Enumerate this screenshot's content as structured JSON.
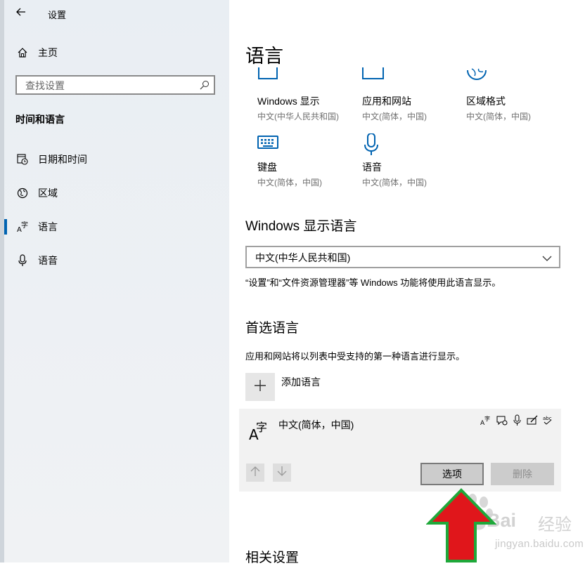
{
  "window": {
    "title": "设置"
  },
  "sidebar": {
    "home_label": "主页",
    "search_placeholder": "查找设置",
    "section_label": "时间和语言",
    "items": [
      {
        "label": "日期和时间",
        "icon": "calendar-clock-icon"
      },
      {
        "label": "区域",
        "icon": "globe-icon"
      },
      {
        "label": "语言",
        "icon": "language-icon",
        "active": true
      },
      {
        "label": "语音",
        "icon": "microphone-icon"
      }
    ]
  },
  "main": {
    "title": "语言",
    "tiles": [
      {
        "name": "Windows 显示",
        "sub": "中文(中华人民共和国)",
        "icon": "monitor-icon"
      },
      {
        "name": "应用和网站",
        "sub": "中文(简体，中国)",
        "icon": "app-window-icon"
      },
      {
        "name": "区域格式",
        "sub": "中文(简体，中国)",
        "icon": "region-format-icon"
      },
      {
        "name": "键盘",
        "sub": "中文(简体，中国)",
        "icon": "keyboard-icon"
      },
      {
        "name": "语音",
        "sub": "中文(简体，中国)",
        "icon": "microphone-icon"
      }
    ],
    "display_language": {
      "heading": "Windows 显示语言",
      "selected": "中文(中华人民共和国)",
      "note": "“设置”和“文件资源管理器”等 Windows 功能将使用此语言显示。"
    },
    "preferred": {
      "heading": "首选语言",
      "description": "应用和网站将以列表中受支持的第一种语言进行显示。",
      "add_label": "添加语言",
      "language": {
        "name": "中文(简体，中国)",
        "features": [
          "display-language-icon",
          "speech-icon",
          "microphone-icon",
          "handwriting-icon",
          "spellcheck-icon"
        ],
        "options_label": "选项",
        "remove_label": "删除"
      }
    },
    "related_heading": "相关设置"
  },
  "watermark": {
    "brand": "Bai",
    "cn": "经验",
    "url": "jingyan.baidu.com"
  },
  "colors": {
    "accent": "#0063b1",
    "annotation_arrow": "#e0161b",
    "annotation_outline": "#1fa83a"
  }
}
